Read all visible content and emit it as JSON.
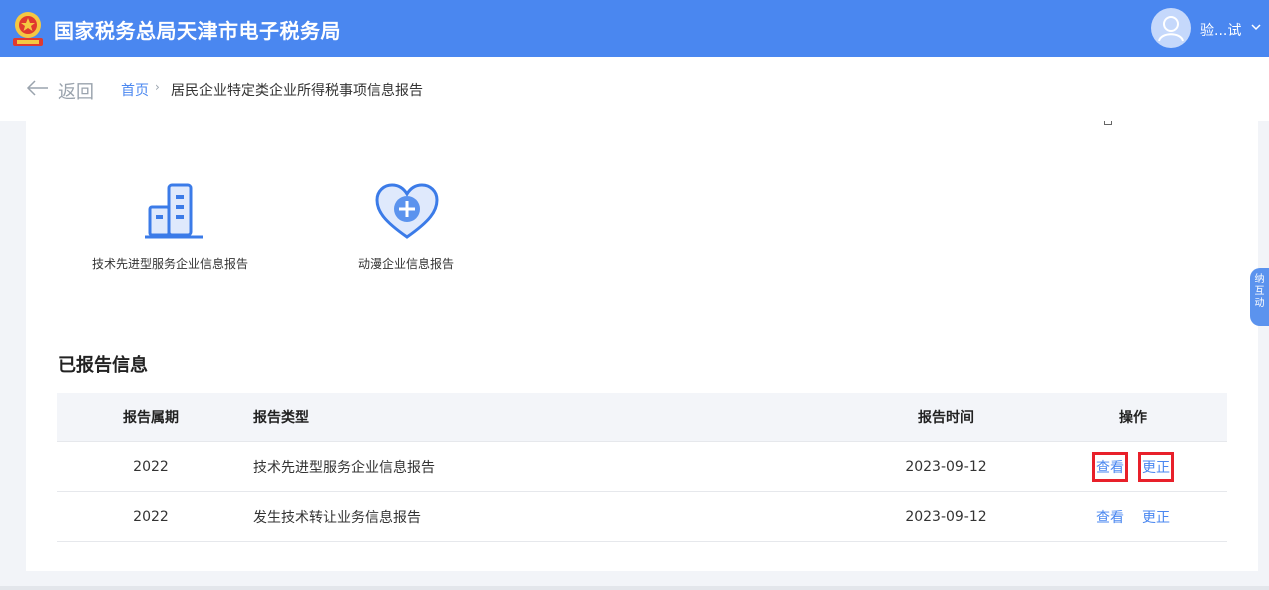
{
  "header": {
    "title": "国家税务总局天津市电子税务局",
    "user_name": "验...试"
  },
  "breadcrumb": {
    "back_label": "返回",
    "home": "首页",
    "separator": "›",
    "current": "居民企业特定类企业所得税事项信息报告"
  },
  "tiles": [
    {
      "label": "技术先进型服务企业信息报告",
      "icon": "building-icon"
    },
    {
      "label": "动漫企业信息报告",
      "icon": "heart-plus-icon"
    }
  ],
  "reported": {
    "title": "已报告信息",
    "columns": [
      "报告属期",
      "报告类型",
      "报告时间",
      "操作"
    ],
    "rows": [
      {
        "period": "2022",
        "type": "技术先进型服务企业信息报告",
        "time": "2023-09-12",
        "view": "查看",
        "correct": "更正"
      },
      {
        "period": "2022",
        "type": "发生技术转让业务信息报告",
        "time": "2023-09-12",
        "view": "查看",
        "correct": "更正"
      }
    ]
  },
  "float_widget": {
    "label": "纳互动"
  },
  "colors": {
    "brand_blue": "#4a87f0",
    "highlight_red": "#e8202a"
  }
}
